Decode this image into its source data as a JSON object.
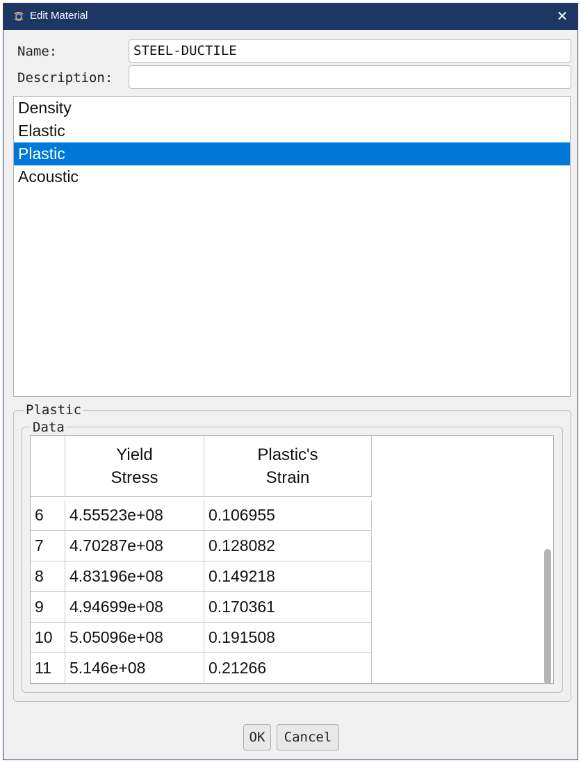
{
  "window": {
    "title": "Edit Material",
    "close_glyph": "✕",
    "icon": "app-icon"
  },
  "form": {
    "name_label": "Name:",
    "name_value": "STEEL-DUCTILE",
    "description_label": "Description:",
    "description_value": ""
  },
  "behaviors": [
    {
      "label": "Density",
      "selected": false
    },
    {
      "label": "Elastic",
      "selected": false
    },
    {
      "label": "Plastic",
      "selected": true
    },
    {
      "label": "Acoustic",
      "selected": false
    }
  ],
  "plastic_group": {
    "title": "Plastic",
    "data_title": "Data",
    "columns": [
      "",
      "Yield\nStress",
      "Plastic's\nStrain"
    ],
    "rows": [
      [
        "6",
        "4.55523e+08",
        "0.106955"
      ],
      [
        "7",
        "4.70287e+08",
        "0.128082"
      ],
      [
        "8",
        "4.83196e+08",
        "0.149218"
      ],
      [
        "9",
        "4.94699e+08",
        "0.170361"
      ],
      [
        "10",
        "5.05096e+08",
        "0.191508"
      ],
      [
        "11",
        "5.146e+08",
        "0.21266"
      ]
    ]
  },
  "buttons": {
    "ok": "OK",
    "cancel": "Cancel"
  },
  "colors": {
    "titlebar": "#1e3663",
    "selection": "#0078d7",
    "dialog_bg": "#f0f0f0"
  }
}
